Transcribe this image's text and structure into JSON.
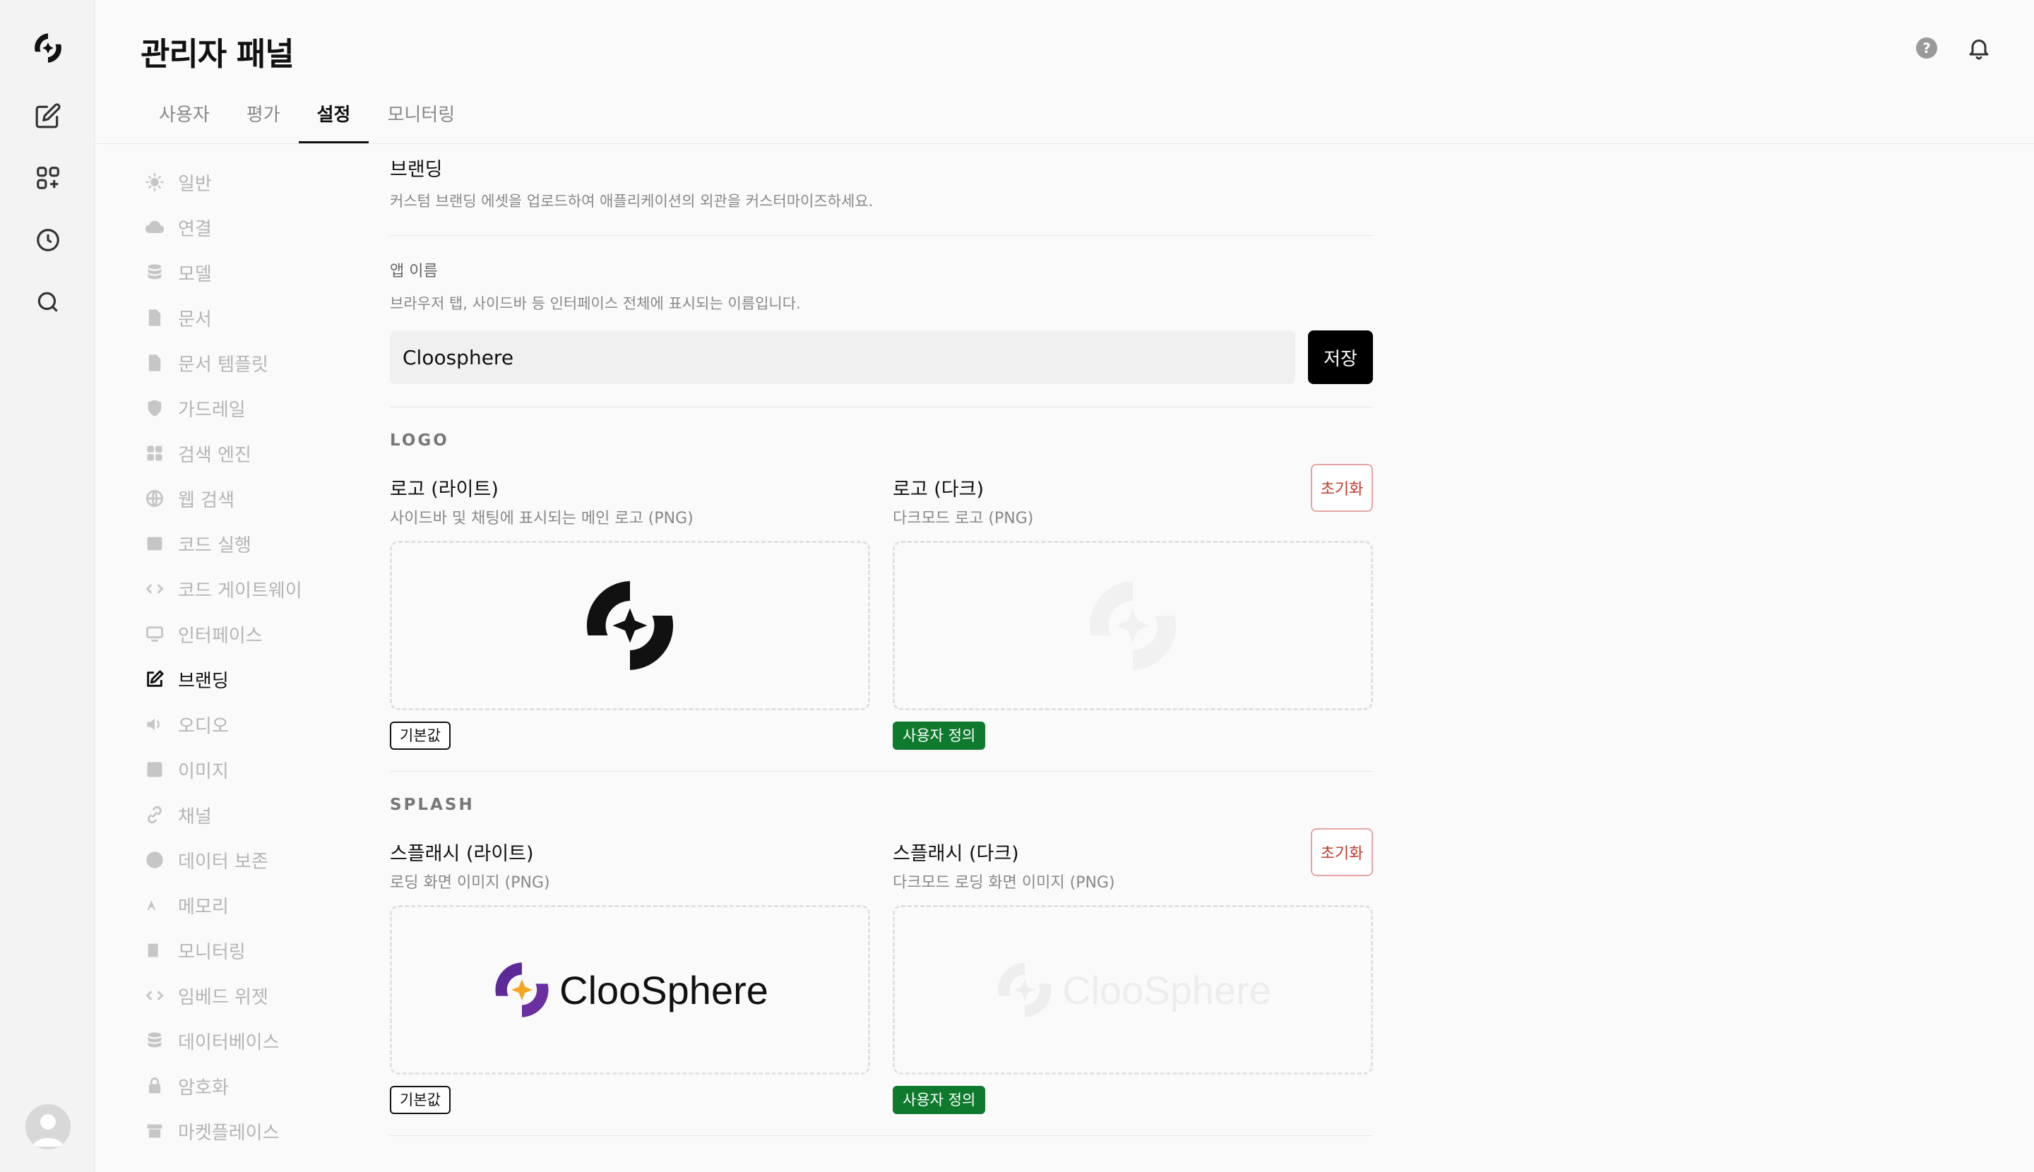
{
  "app": {
    "page_title": "관리자 패널",
    "tabs": [
      {
        "label": "사용자",
        "active": false
      },
      {
        "label": "평가",
        "active": false
      },
      {
        "label": "설정",
        "active": true
      },
      {
        "label": "모니터링",
        "active": false
      }
    ]
  },
  "rail": {
    "icons": [
      "brand-logo-icon",
      "new-chat-icon",
      "apps-icon",
      "history-icon",
      "search-icon"
    ]
  },
  "subnav": {
    "items": [
      {
        "label": "일반",
        "icon": "gear-icon"
      },
      {
        "label": "연결",
        "icon": "cloud-icon"
      },
      {
        "label": "모델",
        "icon": "database-icon"
      },
      {
        "label": "문서",
        "icon": "document-icon"
      },
      {
        "label": "문서 템플릿",
        "icon": "document-template-icon"
      },
      {
        "label": "가드레일",
        "icon": "shield-icon"
      },
      {
        "label": "검색 엔진",
        "icon": "grid-icon"
      },
      {
        "label": "웹 검색",
        "icon": "globe-icon"
      },
      {
        "label": "코드 실행",
        "icon": "terminal-icon"
      },
      {
        "label": "코드 게이트웨이",
        "icon": "code-icon"
      },
      {
        "label": "인터페이스",
        "icon": "monitor-icon"
      },
      {
        "label": "브랜딩",
        "icon": "edit-icon",
        "active": true
      },
      {
        "label": "오디오",
        "icon": "speaker-icon"
      },
      {
        "label": "이미지",
        "icon": "image-icon"
      },
      {
        "label": "채널",
        "icon": "link-icon"
      },
      {
        "label": "데이터 보존",
        "icon": "clock-icon"
      },
      {
        "label": "메모리",
        "icon": "memory-icon"
      },
      {
        "label": "모니터링",
        "icon": "monitoring-icon"
      },
      {
        "label": "임베드 위젯",
        "icon": "embed-icon"
      },
      {
        "label": "데이터베이스",
        "icon": "database-icon"
      },
      {
        "label": "암호화",
        "icon": "lock-icon"
      },
      {
        "label": "마켓플레이스",
        "icon": "archive-icon"
      }
    ]
  },
  "branding": {
    "title": "브랜딩",
    "description": "커스텀 브랜딩 에셋을 업로드하여 애플리케이션의 외관을 커스터마이즈하세요.",
    "app_name": {
      "label": "앱 이름",
      "description": "브라우저 탭, 사이드바 등 인터페이스 전체에 표시되는 이름입니다.",
      "value": "Cloosphere",
      "save_label": "저장"
    },
    "logo": {
      "group_label": "LOGO",
      "light": {
        "title": "로고 (라이트)",
        "subtitle": "사이드바 및 채팅에 표시되는 메인 로고 (PNG)",
        "badge": "기본값"
      },
      "dark": {
        "title": "로고 (다크)",
        "subtitle": "다크모드 로고 (PNG)",
        "badge": "사용자 정의",
        "reset_label": "초기화"
      }
    },
    "splash": {
      "group_label": "SPLASH",
      "light": {
        "title": "스플래시 (라이트)",
        "subtitle": "로딩 화면 이미지 (PNG)",
        "badge": "기본값",
        "wordmark": "ClooSphere"
      },
      "dark": {
        "title": "스플래시 (다크)",
        "subtitle": "다크모드 로딩 화면 이미지 (PNG)",
        "badge": "사용자 정의",
        "reset_label": "초기화",
        "wordmark": "ClooSphere"
      }
    }
  },
  "colors": {
    "accent": "#000000",
    "custom_badge": "#0f7a2e",
    "reset": "#c0392b",
    "splash_purple": "#6b2fa0",
    "splash_orange": "#f5a623"
  }
}
